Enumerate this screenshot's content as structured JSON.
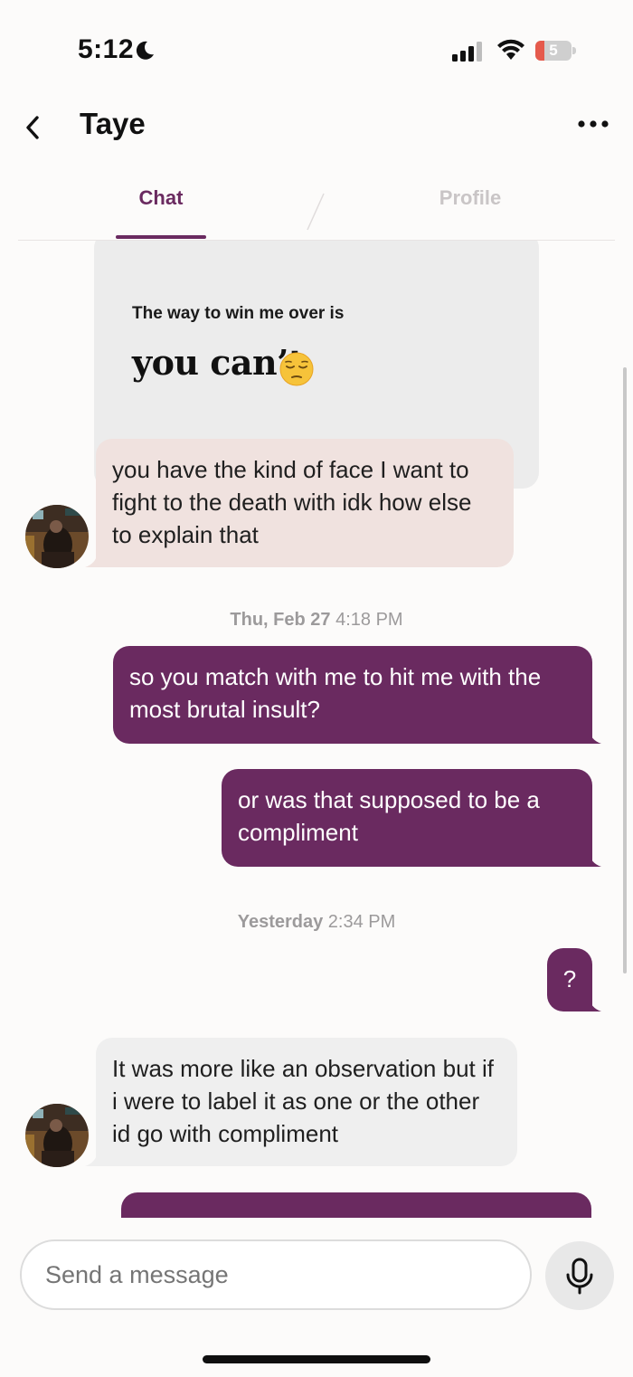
{
  "status_bar": {
    "time": "5:12",
    "battery_level": "5",
    "icons": [
      "moon-icon",
      "signal-icon",
      "wifi-icon",
      "battery-icon"
    ]
  },
  "header": {
    "title": "Taye",
    "icons": [
      "chevron-left-icon",
      "more-icon"
    ]
  },
  "tabs": [
    {
      "label": "Chat",
      "active": true
    },
    {
      "label": "Profile",
      "active": false
    }
  ],
  "prompt_card": {
    "question": "The way to win me over is",
    "answer": "you can’t",
    "emoji": "pensive-face-icon"
  },
  "messages": [
    {
      "from": "them",
      "text": "you have the kind of face I want to fight to the death with idk how else to explain that"
    },
    {
      "timestamp_day": "Thu, Feb 27",
      "timestamp_time": "4:18 PM"
    },
    {
      "from": "me",
      "text": "so you match with me to hit me with the most brutal insult?"
    },
    {
      "from": "me",
      "text": "or was that supposed to be a compliment"
    },
    {
      "timestamp_day": "Yesterday",
      "timestamp_time": "2:34 PM"
    },
    {
      "from": "me",
      "text": "?"
    },
    {
      "from": "them",
      "text": "It was more like an observation but if i were to label it as one or the other id go with compliment"
    },
    {
      "from": "me",
      "text": ""
    }
  ],
  "composer": {
    "placeholder": "Send a message"
  },
  "colors": {
    "accent": "#6a2a60",
    "incoming_pink": "#f0e2df",
    "incoming_grey": "#efefef",
    "card_bg": "#ececec",
    "timestamp": "#9c9a9b"
  }
}
